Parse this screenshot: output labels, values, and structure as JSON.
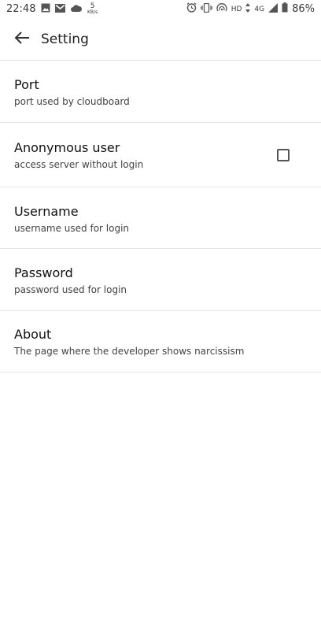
{
  "status_bar": {
    "time": "22:48",
    "net_speed_value": "5",
    "net_speed_unit": "KB/s",
    "network_type_1": "HD",
    "network_type_2": "4G",
    "battery_percent": "86%",
    "icons": [
      "image-icon",
      "gmail-icon",
      "cloud-icon",
      "alarm-icon",
      "vibrate-icon",
      "hotspot-icon",
      "signal-icon",
      "battery-icon"
    ]
  },
  "app_bar": {
    "title": "Setting",
    "back_icon": "arrow-back-icon"
  },
  "settings": [
    {
      "title": "Port",
      "summary": "port used by cloudboard",
      "has_checkbox": false
    },
    {
      "title": "Anonymous user",
      "summary": "access server without login",
      "has_checkbox": true,
      "checked": false
    },
    {
      "title": "Username",
      "summary": "username used for login",
      "has_checkbox": false
    },
    {
      "title": "Password",
      "summary": "password used for login",
      "has_checkbox": false
    },
    {
      "title": "About",
      "summary": "The page where the developer shows narcissism",
      "has_checkbox": false
    }
  ]
}
